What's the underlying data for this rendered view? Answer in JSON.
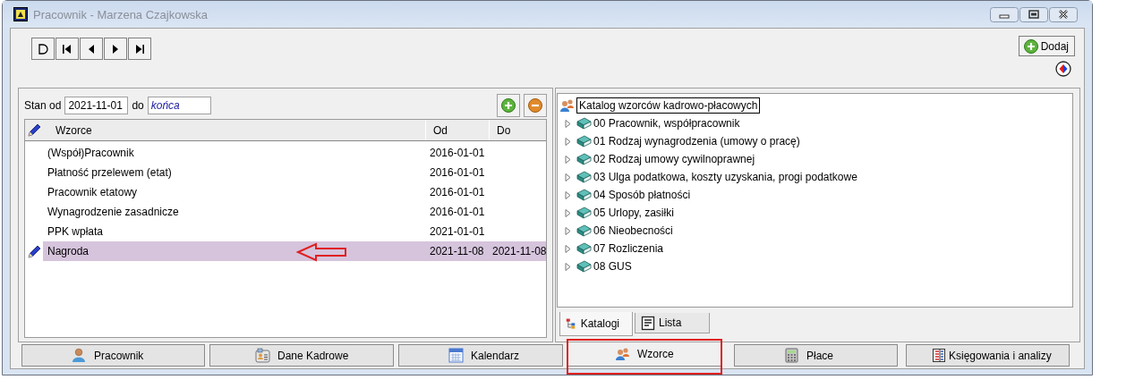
{
  "window": {
    "title": "Pracownik - Marzena Czajkowska"
  },
  "toolbar": {
    "add_button": "Dodaj"
  },
  "filter": {
    "from_label": "Stan od",
    "from_value": "2021-11-01",
    "to_label": "do",
    "to_value": "końca"
  },
  "table": {
    "columns": [
      "Wzorce",
      "Od",
      "Do"
    ],
    "rows": [
      {
        "name": "(Współ)Pracownik",
        "od": "2016-01-01",
        "do": "",
        "selected": false,
        "editing": false
      },
      {
        "name": "Płatność przelewem (etat)",
        "od": "2016-01-01",
        "do": "",
        "selected": false,
        "editing": false
      },
      {
        "name": "Pracownik etatowy",
        "od": "2016-01-01",
        "do": "",
        "selected": false,
        "editing": false
      },
      {
        "name": "Wynagrodzenie zasadnicze",
        "od": "2016-01-01",
        "do": "",
        "selected": false,
        "editing": false
      },
      {
        "name": "PPK wpłata",
        "od": "2021-01-01",
        "do": "",
        "selected": false,
        "editing": false
      },
      {
        "name": "Nagroda",
        "od": "2021-11-08",
        "do": "2021-11-08",
        "selected": true,
        "editing": true
      }
    ]
  },
  "catalog": {
    "root": {
      "label": "Katalog wzorców kadrowo-płacowych",
      "selected": true
    },
    "items": [
      {
        "label": "00 Pracownik, współpracownik",
        "expanded": false
      },
      {
        "label": "01 Rodzaj wynagrodzenia (umowy o pracę)",
        "expanded": false
      },
      {
        "label": "02 Rodzaj umowy cywilnoprawnej",
        "expanded": false
      },
      {
        "label": "03 Ulga podatkowa, koszty uzyskania, progi podatkowe",
        "expanded": false
      },
      {
        "label": "04 Sposób płatności",
        "expanded": false
      },
      {
        "label": "05 Urlopy, zasiłki",
        "expanded": false
      },
      {
        "label": "06 Nieobecności",
        "expanded": false
      },
      {
        "label": "07 Rozliczenia",
        "expanded": false
      },
      {
        "label": "08 GUS",
        "expanded": false
      }
    ]
  },
  "panel_tabs": [
    {
      "label": "Katalogi",
      "selected": true
    },
    {
      "label": "Lista",
      "selected": false
    }
  ],
  "bottom_tabs": [
    {
      "label": "Pracownik",
      "selected": false
    },
    {
      "label": "Dane Kadrowe",
      "selected": false
    },
    {
      "label": "Kalendarz",
      "selected": false
    },
    {
      "label": "Wzorce",
      "selected": true
    },
    {
      "label": "Płace",
      "selected": false
    },
    {
      "label": "Księgowania i analizy",
      "selected": false
    }
  ]
}
